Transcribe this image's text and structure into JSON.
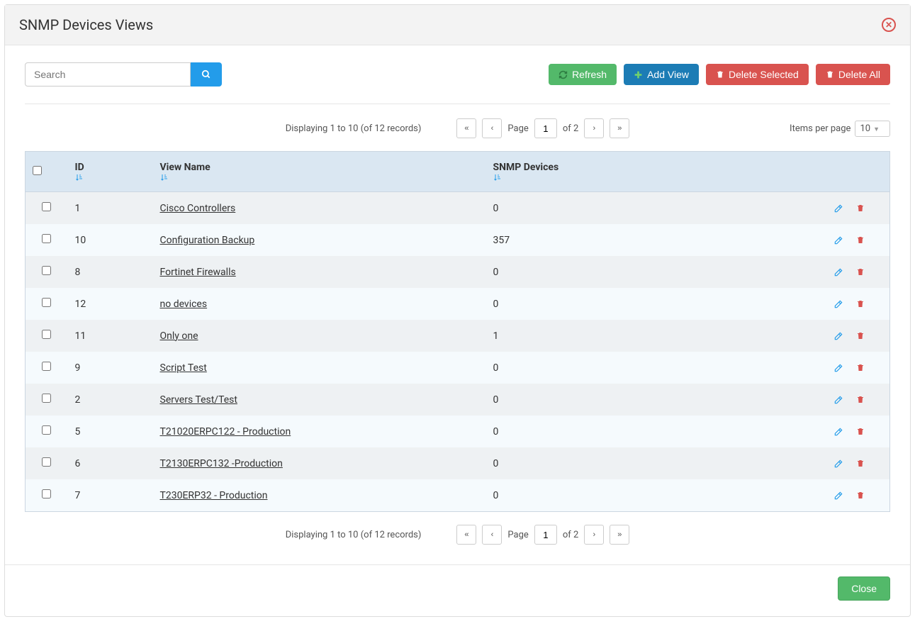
{
  "header": {
    "title": "SNMP Devices Views"
  },
  "search": {
    "placeholder": "Search"
  },
  "buttons": {
    "refresh": "Refresh",
    "add_view": "Add View",
    "delete_selected": "Delete Selected",
    "delete_all": "Delete All",
    "close": "Close"
  },
  "pager": {
    "display_text": "Displaying 1 to 10 (of 12 records)",
    "page_label": "Page",
    "page_value": "1",
    "of_text": "of 2",
    "items_per_page_label": "Items per page",
    "items_per_page_value": "10"
  },
  "columns": {
    "id": "ID",
    "view_name": "View Name",
    "snmp_devices": "SNMP Devices"
  },
  "rows": [
    {
      "id": "1",
      "name": "Cisco Controllers",
      "devices": "0"
    },
    {
      "id": "10",
      "name": "Configuration Backup",
      "devices": "357"
    },
    {
      "id": "8",
      "name": "Fortinet Firewalls",
      "devices": "0"
    },
    {
      "id": "12",
      "name": "no devices",
      "devices": "0"
    },
    {
      "id": "11",
      "name": "Only one",
      "devices": "1"
    },
    {
      "id": "9",
      "name": "Script Test",
      "devices": "0"
    },
    {
      "id": "2",
      "name": "Servers Test/Test",
      "devices": "0"
    },
    {
      "id": "5",
      "name": "T21020ERPC122 - Production",
      "devices": "0"
    },
    {
      "id": "6",
      "name": "T2130ERPC132 -Production",
      "devices": "0"
    },
    {
      "id": "7",
      "name": "T230ERP32 - Production",
      "devices": "0"
    }
  ]
}
